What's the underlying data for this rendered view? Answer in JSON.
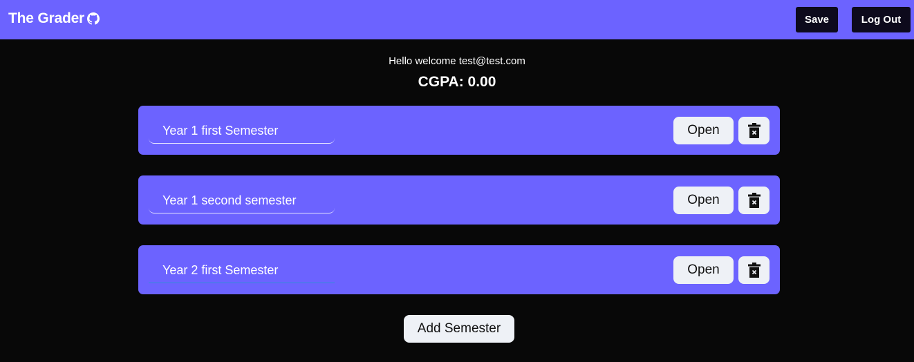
{
  "navbar": {
    "title": "The Grader",
    "brand_icon": "github-icon",
    "save_label": "Save",
    "logout_label": "Log Out",
    "accent_color": "#6c63ff"
  },
  "main": {
    "welcome_text": "Hello welcome test@test.com",
    "cgpa_text": "CGPA: 0.00"
  },
  "semesters": [
    {
      "name": "Year 1 first Semester",
      "open_label": "Open",
      "delete_icon": "trash-icon"
    },
    {
      "name": "Year 1 second semester",
      "open_label": "Open",
      "delete_icon": "trash-icon"
    },
    {
      "name": "Year 2 first Semester",
      "open_label": "Open",
      "delete_icon": "trash-icon",
      "focused": true
    }
  ],
  "add_semester_label": "Add Semester"
}
